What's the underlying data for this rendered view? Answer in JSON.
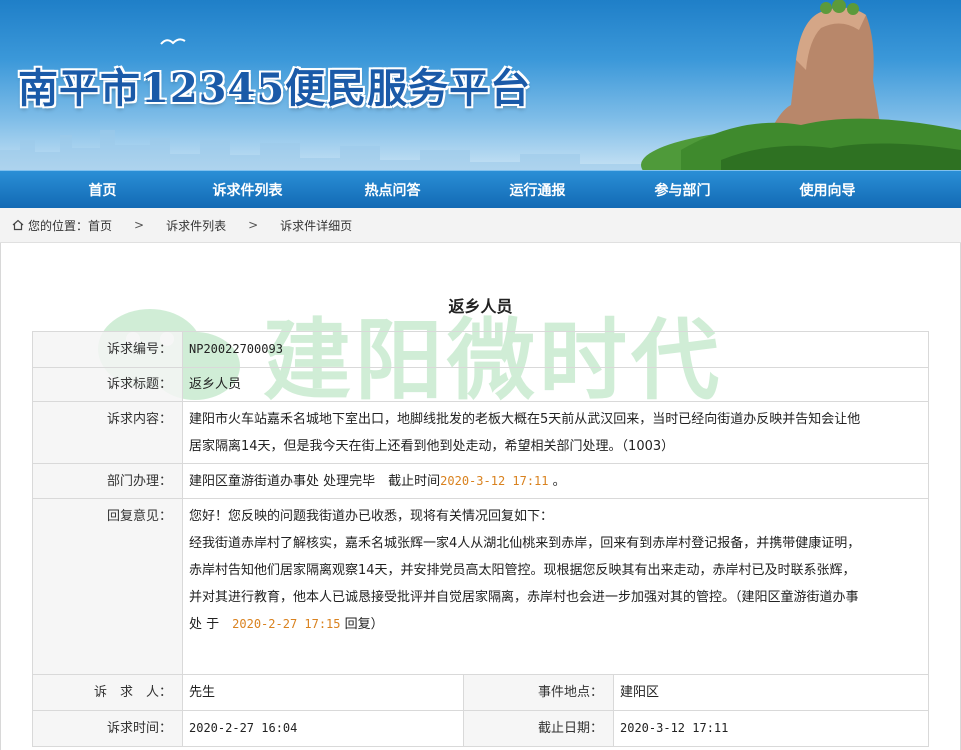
{
  "banner": {
    "title": "南平市12345便民服务平台"
  },
  "nav": {
    "items": [
      "首页",
      "诉求件列表",
      "热点问答",
      "运行通报",
      "参与部门",
      "使用向导"
    ]
  },
  "breadcrumb": {
    "prefix": "您的位置：首页",
    "sep": ">",
    "list": "诉求件列表",
    "current": "诉求件详细页"
  },
  "page": {
    "title": "返乡人员"
  },
  "watermark": {
    "text": "建阳微时代"
  },
  "detail": {
    "id_label": "诉求编号：",
    "id_value": "NP20022700093",
    "subject_label": "诉求标题：",
    "subject_value": "返乡人员",
    "content_label": "诉求内容：",
    "content_line1": "建阳市火车站嘉禾名城地下室出口，地脚线批发的老板大概在5天前从武汉回来，当时已经向街道办反映并告知会让他",
    "content_line2": "居家隔离14天，但是我今天在街上还看到他到处走动，希望相关部门处理。（1003）",
    "dept_label": "部门办理：",
    "dept_value": "建阳区童游街道办事处 处理完毕　截止时间",
    "dept_deadline": "2020-3-12 17:11",
    "dept_suffix": " 。",
    "reply_label": "回复意见：",
    "reply_line1": "您好！您反映的问题我街道办已收悉，现将有关情况回复如下：",
    "reply_line2": "经我街道赤岸村了解核实，嘉禾名城张辉一家4人从湖北仙桃来到赤岸，回来有到赤岸村登记报备，并携带健康证明，",
    "reply_line3": "赤岸村告知他们居家隔离观察14天，并安排党员高太阳管控。现根据您反映其有出来走动，赤岸村已及时联系张辉，",
    "reply_line4": "并对其进行教育，他本人已诚恳接受批评并自觉居家隔离，赤岸村也会进一步加强对其的管控。（建阳区童游街道办事",
    "reply_line5_a": "处 于　",
    "reply_line5_date": "2020-2-27 17:15",
    "reply_line5_b": " 回复）",
    "person_label": "诉　求　人：",
    "person_value": "先生",
    "location_label": "事件地点：",
    "location_value": "建阳区",
    "time_label": "诉求时间：",
    "time_value": "2020-2-27 16:04",
    "deadline_label": "截止日期：",
    "deadline_value": "2020-3-12 17:11"
  },
  "colors": {
    "nav": "#1a77c2",
    "accent_orange": "#d9821f",
    "watermark_green": "#2fb24a"
  }
}
